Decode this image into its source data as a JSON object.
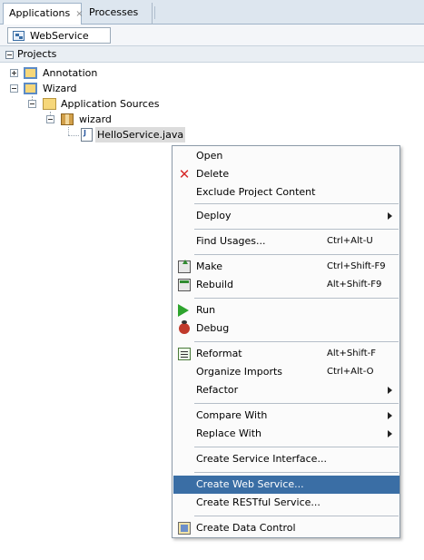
{
  "tabs": [
    {
      "label": "Applications",
      "close": "×"
    },
    {
      "label": "Processes"
    }
  ],
  "toolbar": {
    "project_selector": "WebService"
  },
  "projects_panel": {
    "title": "Projects"
  },
  "tree": {
    "annotation": "Annotation",
    "wizard": "Wizard",
    "app_sources": "Application Sources",
    "package": "wizard",
    "file": "HelloService.java"
  },
  "menu": {
    "open": "Open",
    "delete": "Delete",
    "exclude": "Exclude Project Content",
    "deploy": "Deploy",
    "find_usages": "Find Usages...",
    "find_usages_sc": "Ctrl+Alt-U",
    "make": "Make",
    "make_sc": "Ctrl+Shift-F9",
    "rebuild": "Rebuild",
    "rebuild_sc": "Alt+Shift-F9",
    "run": "Run",
    "debug": "Debug",
    "reformat": "Reformat",
    "reformat_sc": "Alt+Shift-F",
    "organize": "Organize Imports",
    "organize_sc": "Ctrl+Alt-O",
    "refactor": "Refactor",
    "compare": "Compare With",
    "replace": "Replace With",
    "service_interface": "Create Service Interface...",
    "web_service": "Create Web Service...",
    "restful": "Create RESTful Service...",
    "data_control": "Create Data Control"
  },
  "colors": {
    "highlight": "#3a6ea5",
    "tabbar": "#dde6ef"
  }
}
